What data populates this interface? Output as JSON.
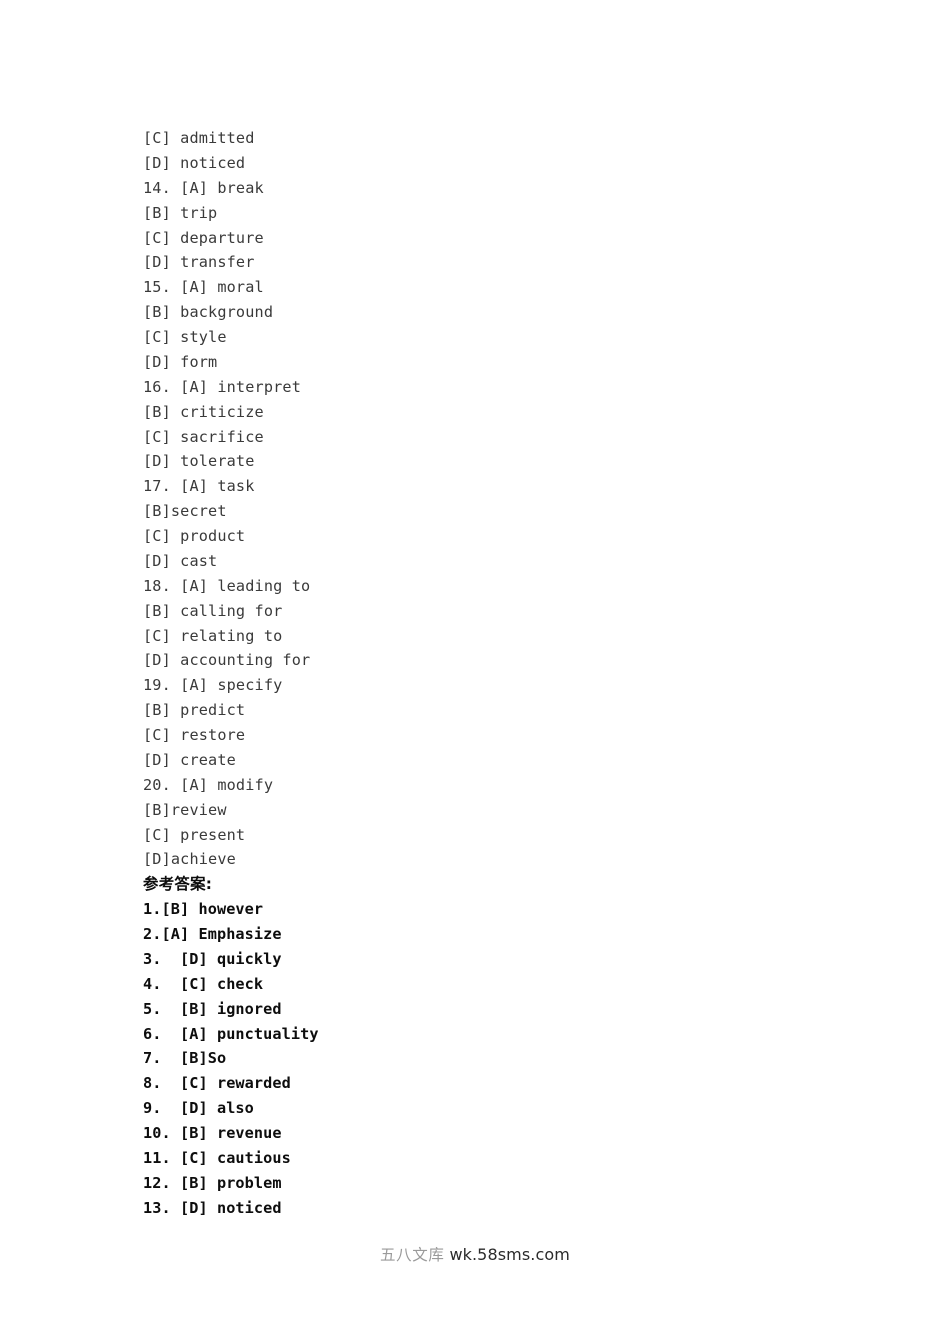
{
  "document": {
    "options_lines": [
      "[C] admitted",
      "[D] noticed",
      "14. [A] break",
      "[B] trip",
      "[C] departure",
      "[D] transfer",
      "15. [A] moral",
      "[B] background",
      "[C] style",
      "[D] form",
      "16. [A] interpret",
      "[B] criticize",
      "[C] sacrifice",
      "[D] tolerate",
      "17. [A] task",
      "[B]secret",
      "[C] product",
      "[D] cast",
      "18. [A] leading to",
      "[B] calling for",
      "[C] relating to",
      "[D] accounting for",
      "19. [A] specify",
      "[B] predict",
      "[C] restore",
      "[D] create",
      "20. [A] modify",
      "[B]review",
      "[C] present",
      "[D]achieve"
    ],
    "answer_heading": "参考答案:",
    "answer_lines": [
      "1.[B] however",
      "2.[A] Emphasize",
      "3.  [D] quickly",
      "4.  [C] check",
      "5.  [B] ignored",
      "6.  [A] punctuality",
      "7.  [B]So",
      "8.  [C] rewarded",
      "9.  [D] also",
      "10. [B] revenue",
      "11. [C] cautious",
      "12. [B] problem",
      "13. [D] noticed"
    ]
  },
  "watermark": {
    "brand": "五八文库",
    "url": "wk.58sms.com"
  }
}
